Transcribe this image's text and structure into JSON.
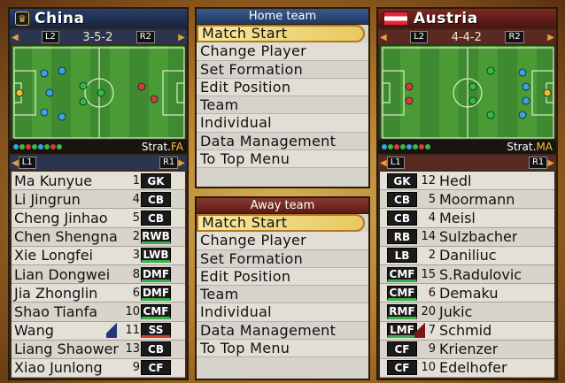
{
  "home": {
    "team": "China",
    "crest_icon": "♛",
    "l_key": "L2",
    "r_key": "R2",
    "formation": "3-5-2",
    "roster_l_key": "L1",
    "roster_r_key": "R1",
    "strat_prefix": "Strat.",
    "strat_code": "FA",
    "players": [
      {
        "name": "Ma Kunyue",
        "num": "1",
        "pos": "GK",
        "style": "gk"
      },
      {
        "name": "Li Jingrun",
        "num": "4",
        "pos": "CB",
        "style": "cb"
      },
      {
        "name": "Cheng Jinhao",
        "num": "5",
        "pos": "CB",
        "style": "cb"
      },
      {
        "name": "Chen Shengnan",
        "num": "2",
        "pos": "RWB",
        "style": "wb"
      },
      {
        "name": "Xie Longfei",
        "num": "3",
        "pos": "LWB",
        "style": "wb"
      },
      {
        "name": "Lian Dongwei",
        "num": "8",
        "pos": "DMF",
        "style": "mid"
      },
      {
        "name": "Jia Zhonglin",
        "num": "6",
        "pos": "DMF",
        "style": "mid"
      },
      {
        "name": "Shao Tianfa",
        "num": "10",
        "pos": "CMF",
        "style": "mid"
      },
      {
        "name": "Wang",
        "num": "11",
        "pos": "SS",
        "style": "ss",
        "cursor": true
      },
      {
        "name": "Liang Shaowen",
        "num": "13",
        "pos": "CB",
        "style": "cb"
      },
      {
        "name": "Xiao Junlong",
        "num": "9",
        "pos": "CF",
        "style": "cf"
      }
    ]
  },
  "away": {
    "team": "Austria",
    "flag_icon": "austria-flag",
    "l_key": "L2",
    "r_key": "R2",
    "formation": "4-4-2",
    "roster_l_key": "L1",
    "roster_r_key": "R1",
    "strat_prefix": "Strat.",
    "strat_code": "MA",
    "players": [
      {
        "name": "Hedl",
        "num": "12",
        "pos": "GK",
        "style": "gk"
      },
      {
        "name": "Moormann",
        "num": "5",
        "pos": "CB",
        "style": "cb"
      },
      {
        "name": "Meisl",
        "num": "4",
        "pos": "CB",
        "style": "cb"
      },
      {
        "name": "Sulzbacher",
        "num": "14",
        "pos": "RB",
        "style": "cb"
      },
      {
        "name": "Daniliuc",
        "num": "2",
        "pos": "LB",
        "style": "lb"
      },
      {
        "name": "S.Radulovic",
        "num": "15",
        "pos": "CMF",
        "style": "mid"
      },
      {
        "name": "Demaku",
        "num": "6",
        "pos": "CMF",
        "style": "mid"
      },
      {
        "name": "Jukic",
        "num": "20",
        "pos": "RMF",
        "style": "mid"
      },
      {
        "name": "Schmid",
        "num": "7",
        "pos": "LMF",
        "style": "mid",
        "cursor": true
      },
      {
        "name": "Krienzer",
        "num": "9",
        "pos": "CF",
        "style": "cf"
      },
      {
        "name": "Edelhofer",
        "num": "10",
        "pos": "CF",
        "style": "cf"
      }
    ]
  },
  "home_menu": {
    "title": "Home team",
    "items": [
      "Match Start",
      "Change Player",
      "Set Formation",
      "Edit Position",
      "Team",
      "Individual",
      "Data Management",
      "To Top Menu"
    ],
    "selected": 0
  },
  "away_menu": {
    "title": "Away team",
    "items": [
      "Match Start",
      "Change Player",
      "Set Formation",
      "Edit Position",
      "Team",
      "Individual",
      "Data Management",
      "To Top Menu"
    ],
    "selected": 0
  },
  "colors": {
    "home_dot": "#3aa0e8",
    "away_dot": "#d83a3a",
    "mid_dot": "#2fbf3a",
    "gk_dot": "#f0c020"
  }
}
